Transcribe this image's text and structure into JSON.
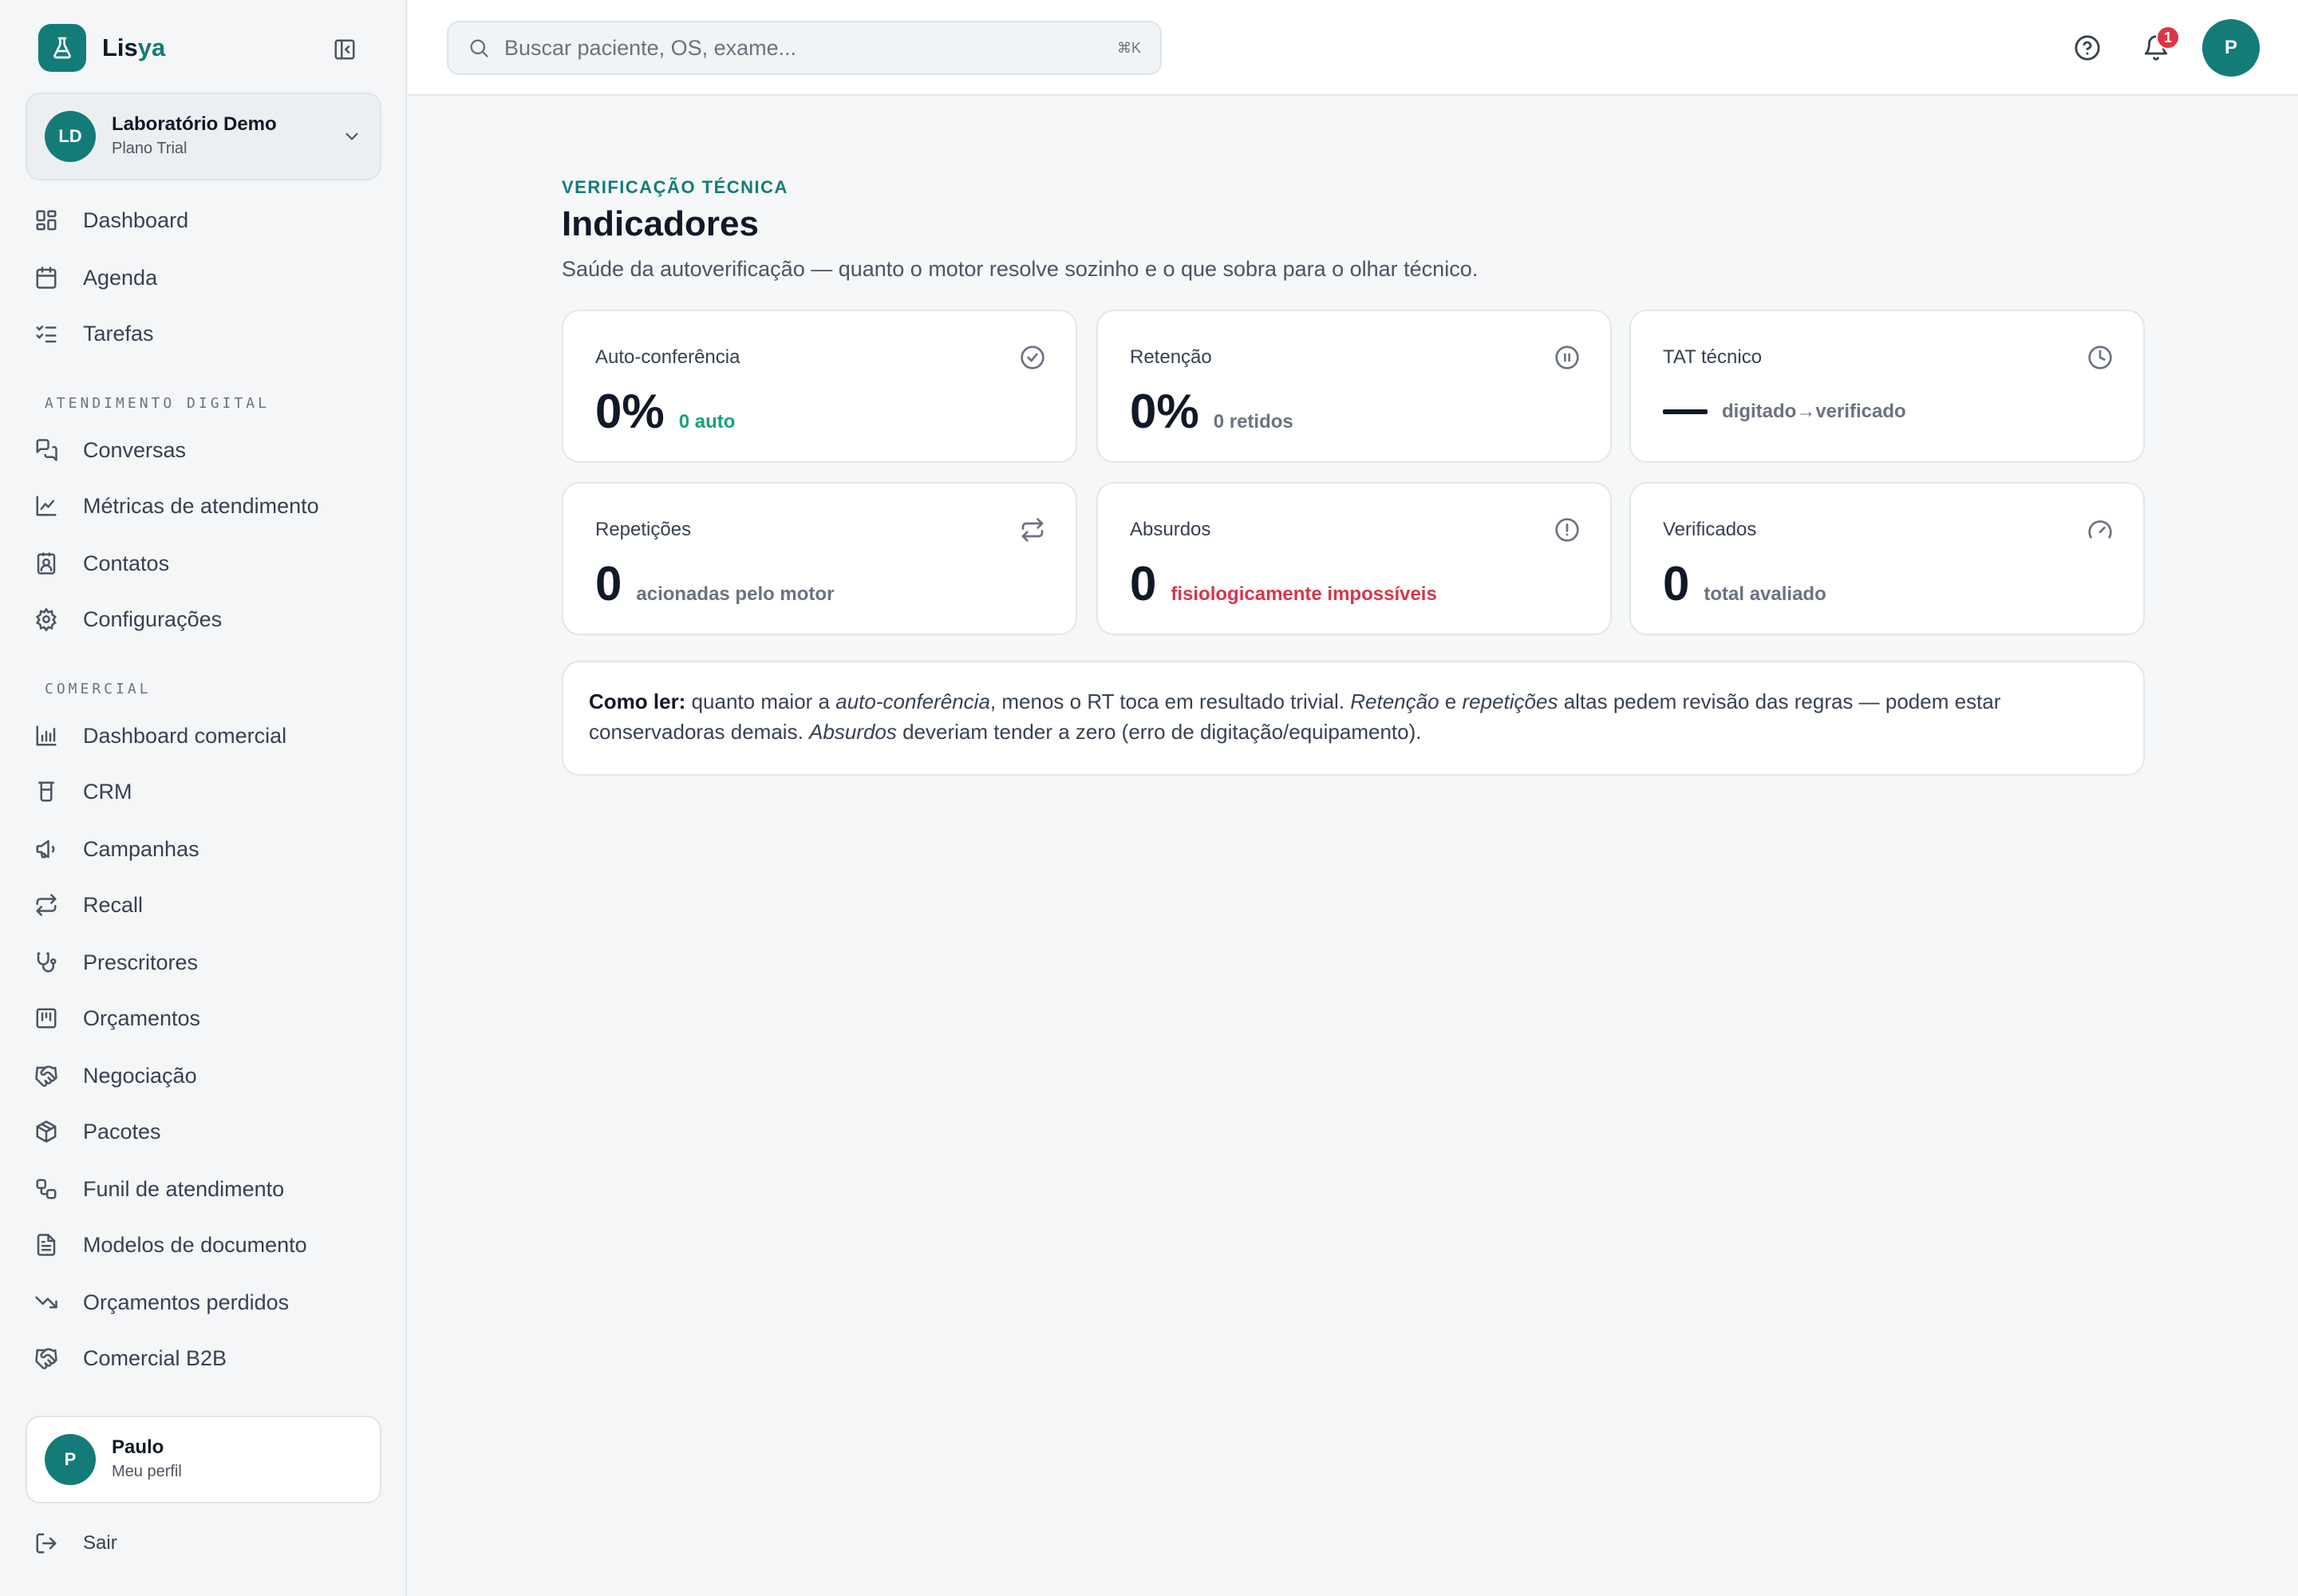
{
  "app": {
    "brand_part1": "Lis",
    "brand_part2": "ya"
  },
  "org": {
    "initials": "LD",
    "name": "Laboratório Demo",
    "plan": "Plano Trial"
  },
  "nav": {
    "main": [
      {
        "label": "Dashboard",
        "icon": "layout-dashboard-icon"
      },
      {
        "label": "Agenda",
        "icon": "calendar-icon"
      },
      {
        "label": "Tarefas",
        "icon": "list-checks-icon"
      }
    ],
    "section_atendimento": "ATENDIMENTO DIGITAL",
    "atendimento": [
      {
        "label": "Conversas",
        "icon": "messages-icon"
      },
      {
        "label": "Métricas de atendimento",
        "icon": "line-chart-icon"
      },
      {
        "label": "Contatos",
        "icon": "contact-icon"
      },
      {
        "label": "Configurações",
        "icon": "gear-icon"
      }
    ],
    "section_comercial": "COMERCIAL",
    "comercial": [
      {
        "label": "Dashboard comercial",
        "icon": "bar-chart-icon"
      },
      {
        "label": "CRM",
        "icon": "crm-icon"
      },
      {
        "label": "Campanhas",
        "icon": "megaphone-icon"
      },
      {
        "label": "Recall",
        "icon": "repeat-icon"
      },
      {
        "label": "Prescritores",
        "icon": "stethoscope-icon"
      },
      {
        "label": "Orçamentos",
        "icon": "receipt-icon"
      },
      {
        "label": "Negociação",
        "icon": "handshake-icon"
      },
      {
        "label": "Pacotes",
        "icon": "package-icon"
      },
      {
        "label": "Funil de atendimento",
        "icon": "workflow-icon"
      },
      {
        "label": "Modelos de documento",
        "icon": "file-text-icon"
      },
      {
        "label": "Orçamentos perdidos",
        "icon": "trending-down-icon"
      },
      {
        "label": "Comercial B2B",
        "icon": "handshake-icon"
      }
    ]
  },
  "profile": {
    "initial": "P",
    "name": "Paulo",
    "sub": "Meu perfil"
  },
  "logout_label": "Sair",
  "topbar": {
    "search_placeholder": "Buscar paciente, OS, exame...",
    "shortcut": "⌘K",
    "notifications_count": "1",
    "user_initial": "P"
  },
  "page": {
    "eyebrow": "VERIFICAÇÃO TÉCNICA",
    "title": "Indicadores",
    "subtitle": "Saúde da autoverificação — quanto o motor resolve sozinho e o que sobra para o olhar técnico."
  },
  "cards": [
    {
      "label": "Auto-conferência",
      "value": "0%",
      "sub": "0 auto",
      "icon": "check-circle-icon",
      "sub_color": "#16a37a"
    },
    {
      "label": "Retenção",
      "value": "0%",
      "sub": "0 retidos",
      "icon": "pause-circle-icon",
      "sub_color": "#6b7280"
    },
    {
      "label": "TAT técnico",
      "value": "",
      "sub": "digitado→verificado",
      "icon": "clock-icon",
      "sub_color": "#6b7280"
    },
    {
      "label": "Repetições",
      "value": "0",
      "sub": "acionadas pelo motor",
      "icon": "repeat-icon",
      "sub_color": "#6b7280"
    },
    {
      "label": "Absurdos",
      "value": "0",
      "sub": "fisiologicamente impossíveis",
      "icon": "alert-circle-icon",
      "sub_color": "#d6364a"
    },
    {
      "label": "Verificados",
      "value": "0",
      "sub": "total avaliado",
      "icon": "gauge-icon",
      "sub_color": "#6b7280"
    }
  ],
  "note": {
    "lead": "Como ler:",
    "t1": " quanto maior a ",
    "e1": "auto-conferência",
    "t2": ", menos o RT toca em resultado trivial. ",
    "e2": "Retenção",
    "t3": " e ",
    "e3": "repetições",
    "t4": " altas pedem revisão das regras — podem estar conservadoras demais. ",
    "e4": "Absurdos",
    "t5": " deveriam tender a zero (erro de digitação/equipamento)."
  },
  "colors": {
    "accent": "#137c78",
    "success": "#16a37a",
    "danger": "#d6364a",
    "badge": "#dc3545"
  }
}
